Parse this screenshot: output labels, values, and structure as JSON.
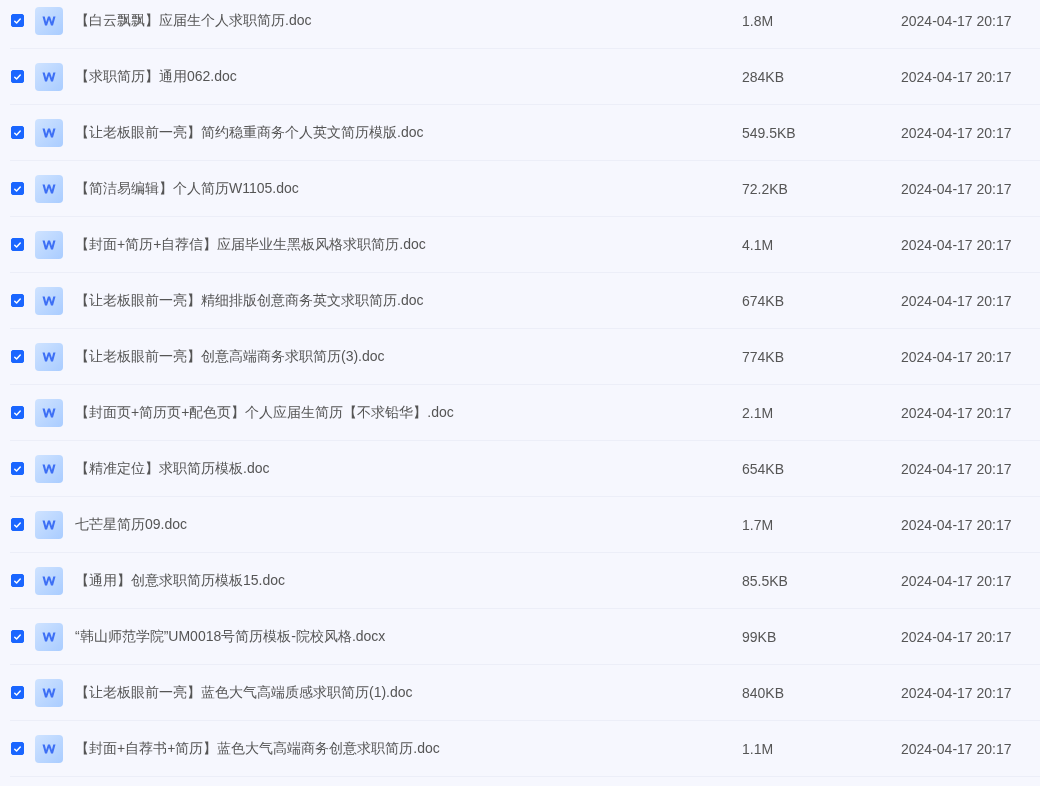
{
  "files": [
    {
      "checked": true,
      "name": "【白云飘飘】应届生个人求职简历.doc",
      "size": "1.8M",
      "modified": "2024-04-17 20:17"
    },
    {
      "checked": true,
      "name": "【求职简历】通用062.doc",
      "size": "284KB",
      "modified": "2024-04-17 20:17"
    },
    {
      "checked": true,
      "name": "【让老板眼前一亮】简约稳重商务个人英文简历模版.doc",
      "size": "549.5KB",
      "modified": "2024-04-17 20:17"
    },
    {
      "checked": true,
      "name": "【简洁易编辑】个人简历W1105.doc",
      "size": "72.2KB",
      "modified": "2024-04-17 20:17"
    },
    {
      "checked": true,
      "name": "【封面+简历+自荐信】应届毕业生黑板风格求职简历.doc",
      "size": "4.1M",
      "modified": "2024-04-17 20:17"
    },
    {
      "checked": true,
      "name": "【让老板眼前一亮】精细排版创意商务英文求职简历.doc",
      "size": "674KB",
      "modified": "2024-04-17 20:17"
    },
    {
      "checked": true,
      "name": "【让老板眼前一亮】创意高端商务求职简历(3).doc",
      "size": "774KB",
      "modified": "2024-04-17 20:17"
    },
    {
      "checked": true,
      "name": "【封面页+简历页+配色页】个人应届生简历【不求铅华】.doc",
      "size": "2.1M",
      "modified": "2024-04-17 20:17"
    },
    {
      "checked": true,
      "name": "【精准定位】求职简历模板.doc",
      "size": "654KB",
      "modified": "2024-04-17 20:17"
    },
    {
      "checked": true,
      "name": "七芒星简历09.doc",
      "size": "1.7M",
      "modified": "2024-04-17 20:17"
    },
    {
      "checked": true,
      "name": "【通用】创意求职简历模板15.doc",
      "size": "85.5KB",
      "modified": "2024-04-17 20:17"
    },
    {
      "checked": true,
      "name": "“韩山师范学院”UM0018号简历模板-院校风格.docx",
      "size": "99KB",
      "modified": "2024-04-17 20:17"
    },
    {
      "checked": true,
      "name": "【让老板眼前一亮】蓝色大气高端质感求职简历(1).doc",
      "size": "840KB",
      "modified": "2024-04-17 20:17"
    },
    {
      "checked": true,
      "name": "【封面+自荐书+简历】蓝色大气高端商务创意求职简历.doc",
      "size": "1.1M",
      "modified": "2024-04-17 20:17"
    }
  ]
}
